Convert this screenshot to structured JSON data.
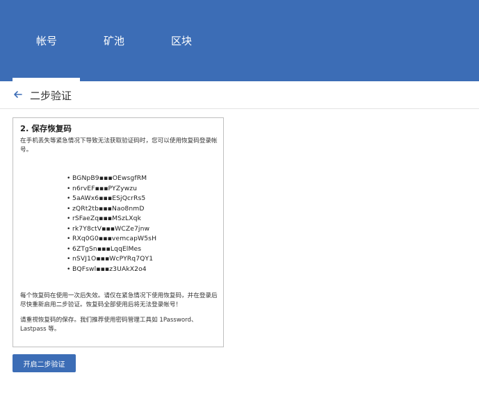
{
  "header": {
    "tabs": [
      {
        "label": "帐号"
      },
      {
        "label": "矿池"
      },
      {
        "label": "区块"
      }
    ],
    "active_tab": "帐号",
    "background_color": "#3c6db6"
  },
  "page": {
    "title": "二步验证",
    "back_icon": "arrow-left-icon"
  },
  "panel": {
    "heading": "2. 保存恢复码",
    "intro": "在手机丢失等紧急情况下导致无法获取验证码时，您可以使用恢复码登录帐号。",
    "codes": [
      "BGNpB9▪▪▪OEwsgfRM",
      "n6rvEF▪▪▪PYZywzu",
      "5aAWx6▪▪▪ESjQcrRs5",
      "zQRt2tb▪▪▪Nao8nmD",
      "rSFaeZq▪▪▪MSzLXqk",
      "rk7Y8ctV▪▪▪WCZe7jnw",
      "RXq0G0▪▪▪vemcapW5sH",
      "6ZTgSn▪▪▪LqqElMes",
      "nSVJ1O▪▪▪WcPYRq7QY1",
      "BQFswl▪▪▪z3UAkX2o4"
    ],
    "note_single_use": "每个恢复码在使用一次后失效。请仅在紧急情况下使用恢复码，并在登录后尽快重新启用二步验证。恢复码全部使用后将无法登录帐号！",
    "note_storage": "请重视恢复码的保存。我们推荐使用密码管理工具如 1Password、Lastpass 等。"
  },
  "actions": {
    "enable_label": "开启二步验证"
  }
}
